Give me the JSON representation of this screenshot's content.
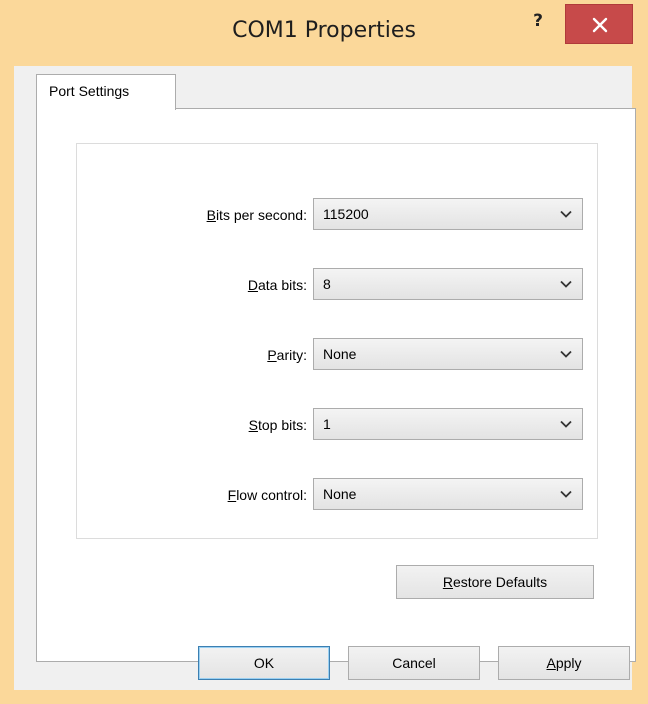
{
  "window": {
    "title": "COM1 Properties",
    "help_label": "?"
  },
  "tabs": [
    {
      "label": "Port Settings",
      "selected": true
    }
  ],
  "settings": [
    {
      "mnemonic": "B",
      "rest": "its per second:",
      "value": "115200"
    },
    {
      "mnemonic": "D",
      "rest": "ata bits:",
      "value": "8"
    },
    {
      "mnemonic": "P",
      "rest": "arity:",
      "value": "None"
    },
    {
      "mnemonic": "S",
      "rest": "top bits:",
      "value": "1"
    },
    {
      "mnemonic": "F",
      "rest": "low control:",
      "value": "None"
    }
  ],
  "restore_button": {
    "mnemonic": "R",
    "rest": "estore Defaults"
  },
  "buttons": {
    "ok": "OK",
    "cancel": "Cancel",
    "apply_mnemonic": "A",
    "apply_rest": "pply"
  },
  "colors": {
    "frame": "#fbd89a",
    "close_button": "#c74a4a",
    "dialog_background": "#f0f0f0",
    "default_button_border": "#3c7fb1"
  },
  "icons": {
    "close": "close-icon",
    "dropdown": "chevron-down-icon"
  }
}
